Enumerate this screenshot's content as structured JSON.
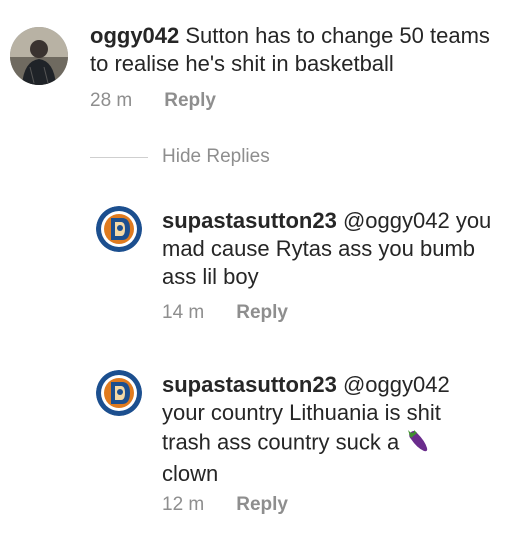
{
  "comment1": {
    "username": "oggy042",
    "text": " Sutton has to change 50 teams to realise he's shit in basketball",
    "time": "28 m",
    "reply_label": "Reply"
  },
  "hide_replies_label": "Hide Replies",
  "reply1": {
    "username": "supastasutton23",
    "mention": "@oggy042",
    "text": " you mad cause Rytas ass you bumb ass lil boy",
    "time": "14 m",
    "reply_label": "Reply"
  },
  "reply2": {
    "username": "supastasutton23",
    "mention": "@oggy042",
    "text": " your country Lithuania is shit trash ass country suck a",
    "text_after_emoji": " clown",
    "emoji_icon": "eggplant-icon",
    "time": "12 m",
    "reply_label": "Reply"
  },
  "colors": {
    "text": "#262626",
    "muted": "#8e8e8e",
    "logo_blue": "#1c4f8f",
    "logo_orange": "#e07b1f"
  }
}
